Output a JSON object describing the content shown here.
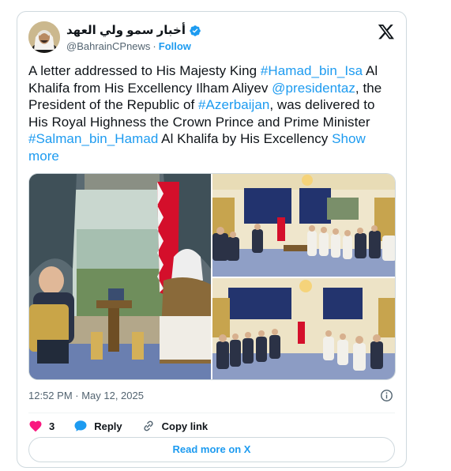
{
  "author": {
    "display_name": "أخبار سمو ولي العهد",
    "handle": "@BahrainCPnews",
    "separator": "·",
    "follow_label": "Follow"
  },
  "tweet": {
    "segments": [
      {
        "text": "A letter addressed to His Majesty King ",
        "link": false
      },
      {
        "text": "#Hamad_bin_Isa",
        "link": true
      },
      {
        "text": " Al Khalifa from His Excellency Ilham Aliyev ",
        "link": false
      },
      {
        "text": "@presidentaz",
        "link": true
      },
      {
        "text": ", the President of the Republic of ",
        "link": false
      },
      {
        "text": "#Azerbaijan",
        "link": true
      },
      {
        "text": ", was delivered to His Royal Highness the Crown Prince and Prime Minister ",
        "link": false
      },
      {
        "text": "#Salman_bin_Hamad",
        "link": true
      },
      {
        "text": " Al Khalifa by His Excellency ",
        "link": false
      },
      {
        "text": "Show more",
        "link": true
      }
    ],
    "timestamp": "12:52 PM · May 12, 2025"
  },
  "actions": {
    "like_count": "3",
    "reply_label": "Reply",
    "copy_label": "Copy link",
    "read_more_label": "Read more on X"
  },
  "colors": {
    "accent": "#1d9bf0",
    "like": "#f91880",
    "text": "#0f1419",
    "muted": "#536471"
  },
  "icons": [
    "verified-badge-icon",
    "x-logo-icon",
    "info-icon",
    "heart-icon",
    "reply-bubble-icon",
    "link-icon"
  ]
}
